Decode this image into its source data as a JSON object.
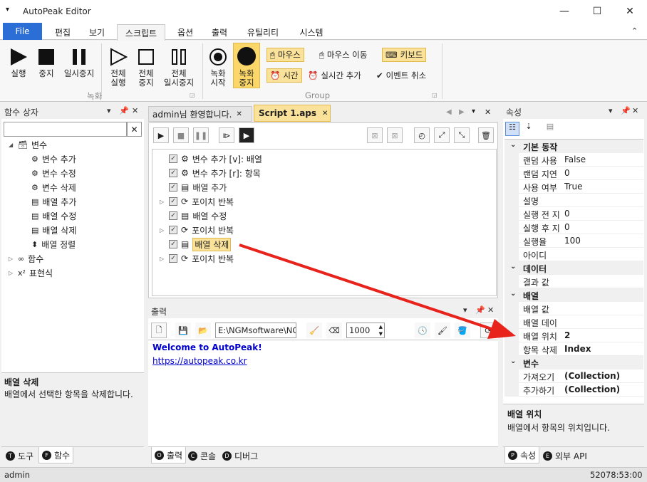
{
  "window": {
    "title": "AutoPeak Editor",
    "minimize": "—",
    "maximize": "☐",
    "close": "✕"
  },
  "ribbon_tabs": [
    "File",
    "편집",
    "보기",
    "스크립트",
    "옵션",
    "출력",
    "유틸리티",
    "시스템"
  ],
  "ribbon": {
    "run": "실행",
    "stop": "중지",
    "pause": "일시중지",
    "run_all": [
      "전체",
      "실행"
    ],
    "stop_all": [
      "전체",
      "중지"
    ],
    "pause_all": [
      "전체",
      "일시중지"
    ],
    "group_record": "녹화",
    "rec_start": [
      "녹화",
      "시작"
    ],
    "rec_stop": [
      "녹화",
      "중지"
    ],
    "mouse": "마우스",
    "mouse_move": "마우스 이동",
    "keyboard": "키보드",
    "time": "시간",
    "realtime_add": "실시간 추가",
    "event_cancel": "이벤트 취소",
    "group_group": "Group"
  },
  "function_box": {
    "title": "함수 상자",
    "search_value": "",
    "clear": "✕",
    "tree": [
      {
        "label": "변수",
        "level": 0,
        "expanded": true
      },
      {
        "label": "변수 추가",
        "level": 1
      },
      {
        "label": "변수 수정",
        "level": 1
      },
      {
        "label": "변수 삭제",
        "level": 1
      },
      {
        "label": "배열 추가",
        "level": 1
      },
      {
        "label": "배열 수정",
        "level": 1
      },
      {
        "label": "배열 삭제",
        "level": 1
      },
      {
        "label": "배열 정렬",
        "level": 1
      },
      {
        "label": "함수",
        "level": 0,
        "expanded": false
      },
      {
        "label": "표현식",
        "level": 0,
        "expanded": false
      }
    ],
    "desc_title": "배열 삭제",
    "desc_text": "배열에서 선택한 항목을 삭제합니다.",
    "bottom_tabs": [
      "도구",
      "함수"
    ]
  },
  "editor": {
    "tabs": [
      "admin님 환영합니다.",
      "Script 1.aps"
    ],
    "lines": [
      {
        "label": "변수 추가 [v]: 배열",
        "expand": false
      },
      {
        "label": "변수 추가 [r]: 항목",
        "expand": false
      },
      {
        "label": "배열 추가",
        "expand": false
      },
      {
        "label": "포이치 반복",
        "expand": true
      },
      {
        "label": "배열 수정",
        "expand": false
      },
      {
        "label": "포이치 반복",
        "expand": true
      },
      {
        "label": "배열 삭제",
        "expand": false,
        "selected": true
      },
      {
        "label": "포이치 반복",
        "expand": true
      }
    ]
  },
  "output": {
    "title": "출력",
    "path": "E:\\NGMsoftware\\NG",
    "interval": "1000",
    "welcome": "Welcome to AutoPeak!",
    "link": "https://autopeak.co.kr",
    "bottom_tabs": [
      "출력",
      "콘솔",
      "디버그"
    ]
  },
  "properties": {
    "title": "속성",
    "categories": [
      {
        "name": "기본 동작",
        "rows": [
          {
            "k": "랜덤 사용",
            "v": "False"
          },
          {
            "k": "랜덤 지연",
            "v": "0"
          },
          {
            "k": "사용 여부",
            "v": "True"
          },
          {
            "k": "설명",
            "v": ""
          },
          {
            "k": "실행 전 지",
            "v": "0"
          },
          {
            "k": "실행 후 지",
            "v": "0"
          },
          {
            "k": "실행율",
            "v": "100"
          },
          {
            "k": "아이디",
            "v": ""
          }
        ]
      },
      {
        "name": "데이터",
        "rows": [
          {
            "k": "결과 값",
            "v": ""
          }
        ]
      },
      {
        "name": "배열",
        "rows": [
          {
            "k": "배열 값",
            "v": ""
          },
          {
            "k": "배열 데이",
            "v": ""
          },
          {
            "k": "배열 위치",
            "v": "2",
            "bold": true
          },
          {
            "k": "항목 삭제",
            "v": "Index",
            "bold": true
          }
        ]
      },
      {
        "name": "변수",
        "rows": [
          {
            "k": "가져오기",
            "v": "(Collection)",
            "bold": true
          },
          {
            "k": "추가하기",
            "v": "(Collection)",
            "bold": true
          }
        ]
      }
    ],
    "desc_title": "배열 위치",
    "desc_text": "배열에서 항목의 위치입니다.",
    "bottom_tabs": [
      "속성",
      "외부 API"
    ]
  },
  "status": {
    "user": "admin",
    "time": "52078:53:00"
  },
  "colors": {
    "accent": "#2b6fd6",
    "highlight": "#fbe29a",
    "arrow": "#e8231c",
    "link": "#0000cc"
  }
}
